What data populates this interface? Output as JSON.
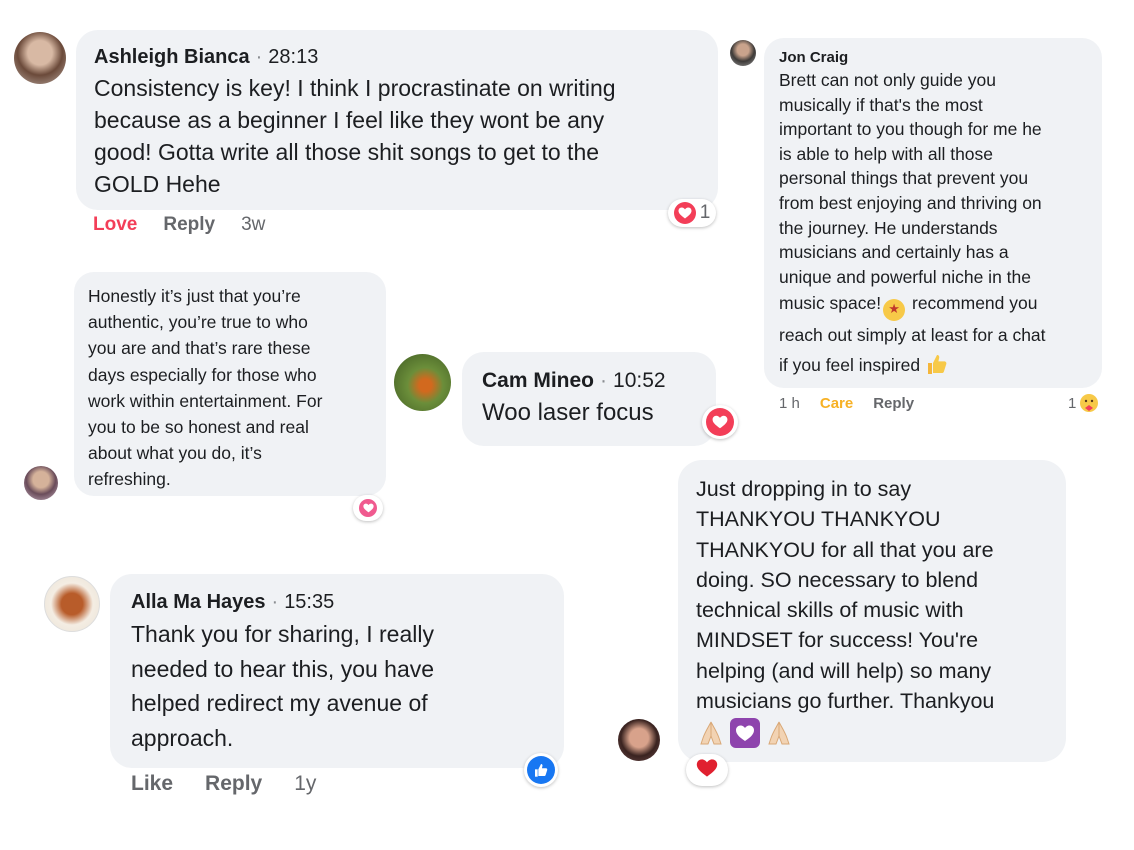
{
  "comments": [
    {
      "name": "Ashleigh Bianca",
      "time": "28:13",
      "text": [
        "Consistency is key! I think I procrastinate on writing",
        "because as a beginner I feel like they wont be any",
        "good! Gotta write all those shit songs to get to the",
        "GOLD Hehe"
      ],
      "actions": {
        "reaction": "Love",
        "reply": "Reply",
        "age": "3w"
      },
      "reaction_count": "1"
    },
    {
      "name": "Jon Craig",
      "text": [
        "Brett can not only guide you",
        "musically if that's the most",
        "important to you though for me he",
        "is able to help with all those",
        "personal things that prevent you",
        "from best enjoying and thriving on",
        "the journey. He understands",
        "musicians and certainly has a",
        "unique and powerful niche in the",
        "music space!",
        "recommend you",
        "reach out simply at least for a chat",
        "if you feel inspired"
      ],
      "actions": {
        "age": "1 h",
        "reaction": "Care",
        "reply": "Reply"
      },
      "reaction_count": "1"
    },
    {
      "text": [
        "Honestly it’s just that you’re",
        "authentic, you’re true to who",
        "you are and that’s rare these",
        "days especially for those who",
        "work within entertainment. For",
        "you to be so honest and real",
        "about what you do, it’s",
        "refreshing."
      ]
    },
    {
      "name": "Cam Mineo",
      "time": "10:52",
      "text": [
        "Woo laser focus"
      ]
    },
    {
      "text": [
        "Just dropping in to say",
        "THANKYOU THANKYOU",
        "THANKYOU for all that you are",
        "doing. SO necessary to blend",
        "technical skills of music with",
        "MINDSET for success! You're",
        "helping (and will help) so many",
        "musicians go further. Thankyou"
      ]
    },
    {
      "name": "Alla Ma Hayes",
      "time": "15:35",
      "text": [
        "Thank you for sharing, I really",
        "needed to hear this, you have",
        "helped redirect my avenue of",
        "approach."
      ],
      "actions": {
        "reaction": "Like",
        "reply": "Reply",
        "age": "1y"
      }
    }
  ],
  "icons": {
    "heart": "heart-icon",
    "like": "thumbs-up-icon",
    "care": "care-emoji-icon",
    "star_eyes": "star-struck-emoji",
    "thumbs": "thumbs-up-emoji",
    "prayer": "folded-hands-emoji",
    "purple_heart": "purple-heart-emoji"
  },
  "colors": {
    "bubble": "#f0f2f5",
    "love": "#f33e58",
    "like": "#1877f2",
    "care": "#f7b125",
    "meta": "#65676b"
  }
}
